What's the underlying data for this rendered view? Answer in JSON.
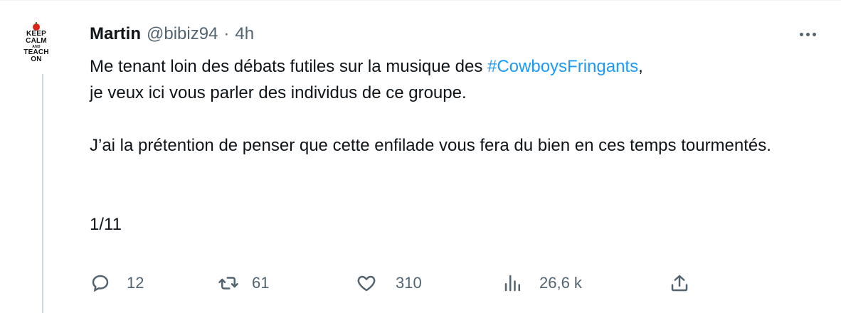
{
  "tweet": {
    "author": {
      "name": "Martin",
      "handle": "@bibiz94",
      "avatar_text": [
        "KEEP",
        "CALM",
        "AND",
        "TEACH",
        "ON"
      ]
    },
    "separator": "·",
    "time": "4h",
    "body": {
      "line1_before": "Me tenant loin des débats futiles sur la musique des ",
      "hashtag": "#CowboysFringants",
      "line1_after": ",",
      "line2": "je veux ici vous parler des individus de ce groupe.",
      "para2": "J’ai la prétention de penser que cette enfilade vous fera du bien en ces temps tourmentés.",
      "para3": "1/11"
    },
    "actions": {
      "replies": "12",
      "retweets": "61",
      "likes": "310",
      "views": "26,6 k"
    }
  },
  "colors": {
    "text": "#0f1419",
    "secondary": "#536471",
    "link": "#1d9bf0",
    "thread_line": "#cfd9de"
  },
  "icons": [
    "reply-icon",
    "retweet-icon",
    "like-icon",
    "views-icon",
    "share-icon",
    "more-icon"
  ]
}
